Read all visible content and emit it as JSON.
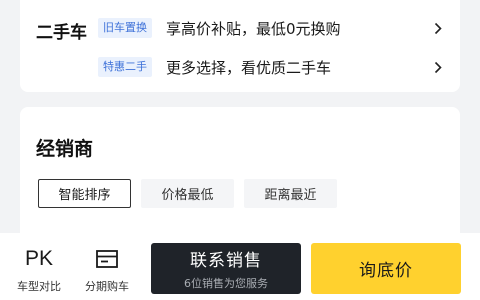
{
  "used_car": {
    "title": "二手车",
    "rows": [
      {
        "tag": "旧车置换",
        "text": "享高价补贴，最低0元换购"
      },
      {
        "tag": "特惠二手",
        "text": "更多选择，看优质二手车"
      }
    ]
  },
  "dealer": {
    "title": "经销商",
    "sort_options": [
      "智能排序",
      "价格最低",
      "距离最近"
    ],
    "active_sort": "智能排序"
  },
  "bottom_bar": {
    "compare": {
      "icon_text": "PK",
      "label": "车型对比"
    },
    "installment": {
      "icon": "card-icon",
      "label": "分期购车"
    },
    "contact": {
      "label": "联系销售",
      "sub": "6位销售为您服务"
    },
    "price": {
      "label": "询底价"
    }
  },
  "colors": {
    "tag_bg": "#eaf1fd",
    "tag_text": "#3f72d9",
    "contact_bg": "#1f2329",
    "price_bg": "#ffd12e",
    "page_bg": "#f2f3f5"
  }
}
